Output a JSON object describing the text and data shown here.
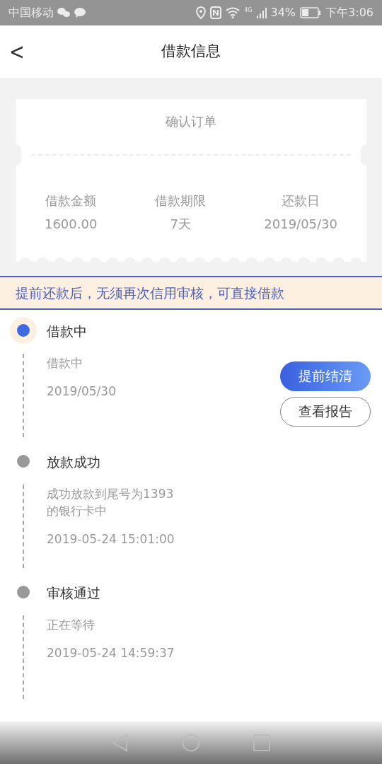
{
  "status_bar": {
    "carrier": "中国移动",
    "network": "4G",
    "battery": "34%",
    "time": "下午3:06"
  },
  "header": {
    "back": "<",
    "title": "借款信息"
  },
  "ticket": {
    "title": "确认订单",
    "fields": [
      {
        "label": "借款金额",
        "value": "1600.00"
      },
      {
        "label": "借款期限",
        "value": "7天"
      },
      {
        "label": "还款日",
        "value": "2019/05/30"
      }
    ]
  },
  "notice": "提前还款后，无须再次信用审核，可直接借款",
  "timeline": [
    {
      "title": "借款中",
      "active": true,
      "detail": "借款中",
      "time": "2019/05/30",
      "buttons": [
        {
          "label": "提前结清",
          "kind": "primary"
        },
        {
          "label": "查看报告",
          "kind": "outline"
        }
      ]
    },
    {
      "title": "放款成功",
      "active": false,
      "detail": "成功放款到尾号为1393\n的银行卡中",
      "time": "2019-05-24 15:01:00"
    },
    {
      "title": "审核通过",
      "active": false,
      "detail": "正在等待",
      "time": "2019-05-24 14:59:37"
    }
  ]
}
